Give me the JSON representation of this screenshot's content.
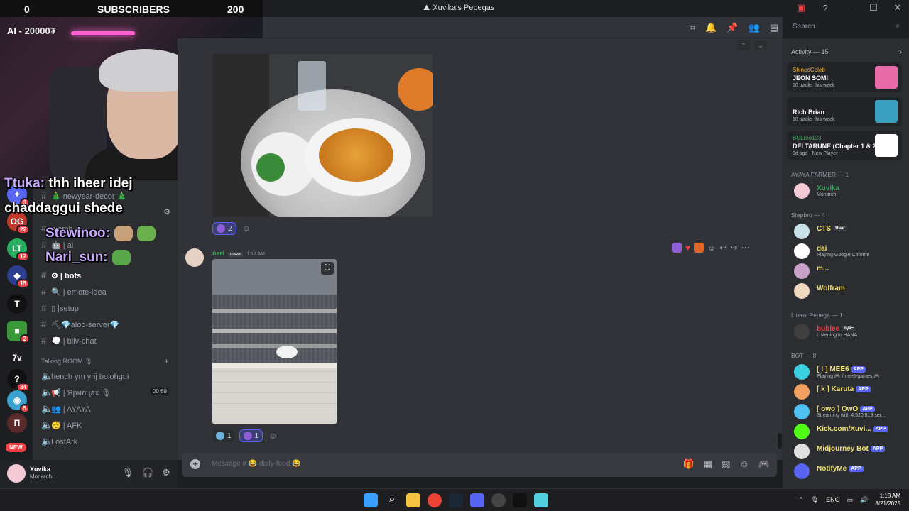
{
  "stream": {
    "subscribers_left": "0",
    "subscribers_label": "SUBSCRIBERS",
    "subscribers_right": "200",
    "ai_label": "AI - ",
    "ai_value": "20000₮"
  },
  "window": {
    "title": "Xuvika's Pepegas"
  },
  "chat_overlay": [
    {
      "name": "Ttuka:",
      "text": " thh iheer idej"
    },
    {
      "name": "",
      "text": "chaddaggui shede"
    },
    {
      "name": "Stewinoo:",
      "text": ""
    },
    {
      "name": "Nari_sun:",
      "text": ""
    }
  ],
  "channels": [
    {
      "name": "newyear-decor",
      "prefix": "🎄 ",
      "suffix": " 🎄",
      "active": false
    },
    {
      "name": "merch",
      "prefix": "",
      "suffix": "",
      "active": false
    },
    {
      "name": "| ai",
      "prefix": "🤖 ",
      "suffix": "",
      "active": false
    },
    {
      "name": "| bots",
      "prefix": "⚙ ",
      "suffix": "",
      "active": true
    },
    {
      "name": "| emote-idea",
      "prefix": "🔍 ",
      "suffix": "",
      "active": false
    },
    {
      "name": "|setup",
      "prefix": "▯ ",
      "suffix": "",
      "active": false
    },
    {
      "name": "aloo-server",
      "prefix": "⛏💎",
      "suffix": "💎",
      "active": false
    },
    {
      "name": "| biiv-chat",
      "prefix": "💭 ",
      "suffix": "",
      "active": false
    }
  ],
  "voice_category": "Talking ROOM 🎙",
  "voice_channels": [
    {
      "name": "hench ym yrij bolohgui",
      "count": ""
    },
    {
      "name": "📢 | Ярилцах 🎙",
      "count": "00 69"
    },
    {
      "name": "👥 | AYAYA",
      "count": ""
    },
    {
      "name": "😴 | AFK",
      "count": ""
    },
    {
      "name": "LostArk",
      "count": ""
    }
  ],
  "rail_badges": [
    "3",
    "22",
    "12",
    "15",
    "2",
    "34",
    "5"
  ],
  "rail_new": "NEW",
  "user": {
    "name": "Xuvika",
    "status": "Monarch"
  },
  "search": {
    "placeholder": "Search"
  },
  "messages": {
    "reactions_top": [
      {
        "count": "2"
      }
    ],
    "author": "nari",
    "author_tag": "mwa",
    "time": "1:17 AM",
    "reactions_bottom": [
      {
        "count": "1"
      },
      {
        "count": "1"
      }
    ]
  },
  "composer": {
    "placeholder": "Message # 😂 daily-food 😂"
  },
  "members": {
    "activity_header": "Activity — 15",
    "activity": [
      {
        "who": "ShineeCeleb",
        "what": "JEON SOMI",
        "sub": "10 tracks this week",
        "thumb": "#e86aa8"
      },
      {
        "who": "",
        "what": "Rich Brian",
        "sub": "10 tracks this week",
        "thumb": "#3aa0c0"
      },
      {
        "who": "BULroo123",
        "what": "DELTARUNE (Chapter 1 & 2...",
        "sub": "9d ago · New Player",
        "thumb": "#ffffff"
      }
    ],
    "groups": [
      {
        "title": "AYAYA FARMER — 1",
        "members": [
          {
            "name": "Xuvika",
            "status": "Monarch",
            "color": "#3ba55d",
            "av": "#f2c9d4"
          }
        ]
      },
      {
        "title": "Stepbro — 4",
        "members": [
          {
            "name": "CTS",
            "status": "",
            "tag": "Янаг",
            "color": "#f0e070",
            "av": "#c8e0e8"
          },
          {
            "name": "dai",
            "status": "Playing Google Chrome",
            "color": "#f0e070",
            "av": "#ffffff"
          },
          {
            "name": "m...",
            "status": "",
            "color": "#f0e070",
            "av": "#c8a0c8"
          },
          {
            "name": "Wolfram",
            "status": "",
            "color": "#f0e070",
            "av": "#f0d8c0"
          }
        ]
      },
      {
        "title": "Literal Pepega — 1",
        "members": [
          {
            "name": "bublee",
            "status": "Listening to HANA",
            "tag": "nya~",
            "color": "#f23f43",
            "av": "#404040"
          }
        ]
      },
      {
        "title": "BOT — 8",
        "members": [
          {
            "name": "[ ! ] MEE6",
            "status": "Playing 🎮 /mee6-games 🎮",
            "app": "APP",
            "color": "#f0e070",
            "av": "#3ad0e0"
          },
          {
            "name": "[ k ] Karuta",
            "status": "",
            "app": "APP",
            "color": "#f0e070",
            "av": "#f0a060"
          },
          {
            "name": "[ owo ] OwO",
            "status": "Streaming with 4,520,819 ser...",
            "app": "APP",
            "color": "#f0e070",
            "av": "#50c0f0"
          },
          {
            "name": "Kick.com/Xuvi...",
            "status": "",
            "app": "APP",
            "color": "#f0e070",
            "av": "#53fc18"
          },
          {
            "name": "Midjourney Bot",
            "status": "",
            "app": "APP",
            "color": "#f0e070",
            "av": "#e0e0e0"
          },
          {
            "name": "NotifyMe",
            "status": "",
            "app": "APP",
            "color": "#f0e070",
            "av": "#5865f2"
          }
        ]
      }
    ]
  },
  "taskbar": {
    "lang": "ENG",
    "time": "1:18 AM",
    "date": "8/21/2025"
  }
}
